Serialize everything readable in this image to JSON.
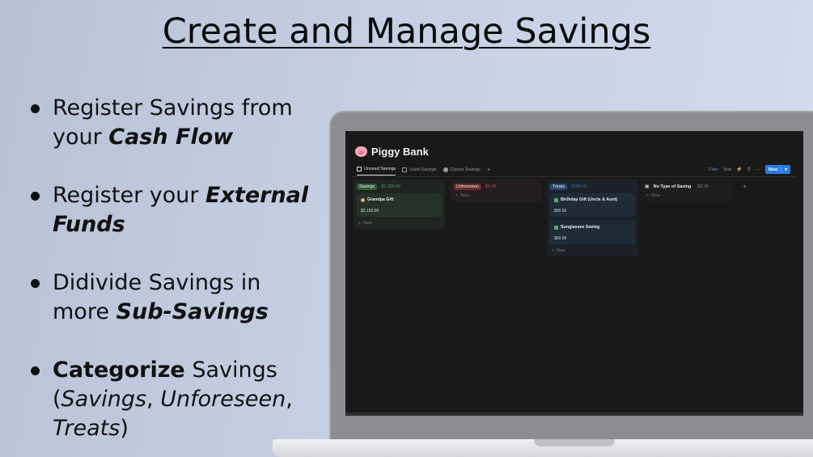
{
  "slide": {
    "title": "Create and Manage Savings",
    "bullets": [
      {
        "plain": "Register Savings from your ",
        "emph": "Cash Flow"
      },
      {
        "plain": "Register your ",
        "emph": "External Funds"
      },
      {
        "plain": "Didivide Savings in more ",
        "emph": "Sub-Savings"
      },
      {
        "bold": "Categorize",
        "plain": " Savings (",
        "i1": "Savings",
        "sep1": ", ",
        "i2": "Unforeseen",
        "sep2": ",",
        "i3": "Treats",
        "close": ")"
      }
    ]
  },
  "app": {
    "title": "Piggy Bank",
    "tabs": [
      "Unused Savings",
      "Used Savings",
      "Closed Savings"
    ],
    "toolbar": {
      "filter": "Filter",
      "sort": "Sort",
      "new": "New"
    },
    "columns": [
      {
        "label": "Savings",
        "total": "$2,150.00",
        "label_bg": "#2f5a3c",
        "total_color": "#5e9c6e",
        "column_bg": "#1f2420",
        "cards": [
          {
            "title": "Grandpa Gift",
            "amount": "$2,150.00",
            "icon": "heart-icon",
            "bg": "#253228",
            "icon_color": "#e8a07a"
          }
        ],
        "add": "New"
      },
      {
        "label": "Unforeseen",
        "total": "$0.00",
        "label_bg": "#6b2b2b",
        "total_color": "#b45c5c",
        "column_bg": "#241d1d",
        "cards": [],
        "add": "New"
      },
      {
        "label": "Treats",
        "total": "$100.00",
        "label_bg": "#27466e",
        "total_color": "#4a7fc0",
        "column_bg": "#1c2128",
        "cards": [
          {
            "title": "Birthday Gift (Uncle & Aunt)",
            "amount": "$50.00",
            "icon": "money-icon",
            "bg": "#1f2c38",
            "icon_color": "#4bb06a"
          },
          {
            "title": "Sunglasses Saving",
            "amount": "$50.00",
            "icon": "money-icon",
            "bg": "#1f2c38",
            "icon_color": "#4bb06a"
          }
        ],
        "add": "New"
      },
      {
        "label": "No Type of Saving",
        "total": "$0.00",
        "label_bg": "transparent",
        "total_color": "#8a8a8a",
        "column_bg": "#1d1d1d",
        "cards": [],
        "add": "New"
      }
    ]
  }
}
